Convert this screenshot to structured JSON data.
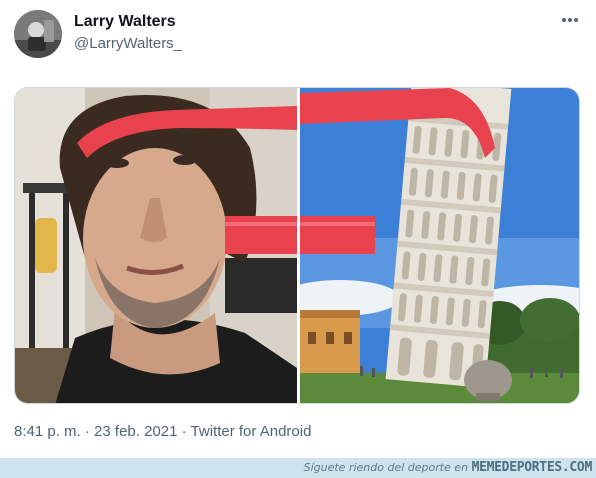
{
  "tweet": {
    "display_name": "Larry Walters",
    "handle": "@LarryWalters_",
    "time": "8:41 p. m.",
    "separator_1": " · ",
    "date": "23 feb. 2021",
    "separator_2": " · ",
    "source": "Twitter for Android",
    "more_icon": "more-horizontal-icon",
    "images": [
      {
        "subject": "man-selfie-with-red-ribbon"
      },
      {
        "subject": "leaning-tower-of-pisa-with-red-ribbon"
      }
    ]
  },
  "footer": {
    "tagline": "Síguete riendo del deporte en",
    "brand": "MEMEDEPORTES.COM"
  },
  "colors": {
    "ribbon": "#e8424f",
    "sky": "#3b7fd6",
    "footer_bg": "#cde3ee",
    "secondary_text": "#536471"
  }
}
